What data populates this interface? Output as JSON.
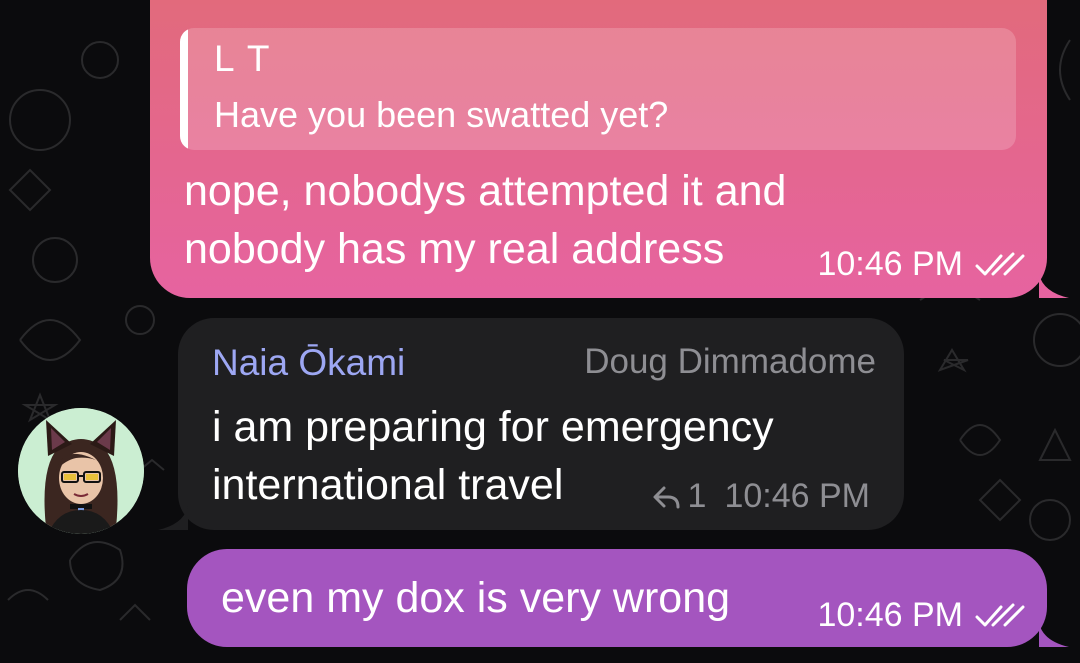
{
  "messages": {
    "outgoing_1": {
      "reply_author": "L T",
      "reply_text": "Have you been swatted yet?",
      "text": "nope, nobodys attempted it and\nnobody has my real address",
      "time": "10:46 PM",
      "status": "read"
    },
    "incoming_1": {
      "sender": "Naia Ōkami",
      "title": "Doug Dimmadome",
      "text": "i am preparing for emergency\ninternational travel",
      "reply_count": "1",
      "time": "10:46 PM"
    },
    "outgoing_2": {
      "text": "even my dox is very wrong",
      "time": "10:46 PM",
      "status": "read"
    }
  },
  "colors": {
    "background": "#0b0b0d",
    "outgoing_gradient_top": "#e26a7c",
    "outgoing_gradient_bottom": "#e663a0",
    "outgoing_purple": "#a455bf",
    "incoming_bubble": "#1f1f21",
    "sender_name": "#9da7f3",
    "muted_text": "#8e8e93",
    "avatar_bg": "#cbeed2"
  },
  "icons": {
    "read_status": "double-check-icon",
    "replies": "reply-arrow-icon",
    "avatar": "cat-ear-girl-avatar"
  }
}
